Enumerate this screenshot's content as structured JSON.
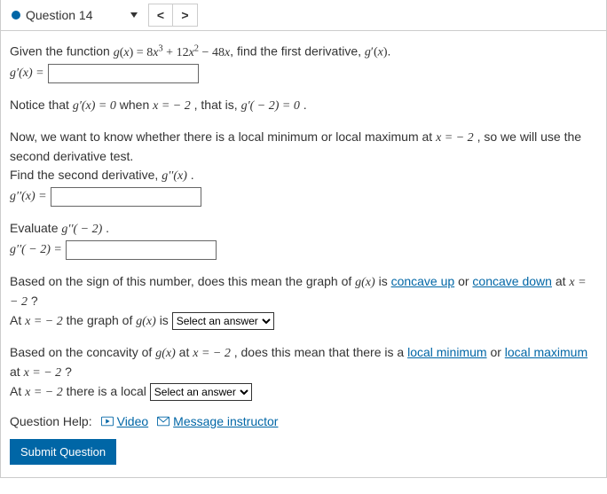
{
  "header": {
    "question_label": "Question 14",
    "prev_glyph": "<",
    "next_glyph": ">"
  },
  "p1": {
    "t1": "Given the function ",
    "fn": "g(x) = 8x³ + 12x² − 48x",
    "t2": ", find the first derivative, ",
    "d1": "g′(x)",
    "t3": "."
  },
  "row1": {
    "lhs": "g′(x) = "
  },
  "p2": {
    "t1": "Notice that ",
    "m1": "g′(x) = 0",
    "t2": " when ",
    "m2": "x = − 2",
    "t3": ", that is, ",
    "m3": "g′( − 2) = 0",
    "t4": "."
  },
  "p3": {
    "t1": "Now, we want to know whether there is a local minimum or local maximum at ",
    "m1": "x = − 2",
    "t2": ", so we will use the second derivative test.",
    "t3": "Find the second derivative, ",
    "m2": "g′′(x)",
    "t4": "."
  },
  "row2": {
    "lhs": "g′′(x) = "
  },
  "p4": {
    "t1": "Evaluate ",
    "m1": "g′′( − 2)",
    "t2": "."
  },
  "row3": {
    "lhs": "g′′( − 2) = "
  },
  "p5": {
    "t1": "Based on the sign of this number, does this mean the graph of ",
    "m1": "g(x)",
    "t2": " is ",
    "link1": "concave up",
    "t3": " or ",
    "link2": "concave down",
    "t4": " at ",
    "m2": "x = − 2",
    "t5": "?",
    "ans_pre1": "At ",
    "ans_m": "x = − 2",
    "ans_pre2": " the graph of ",
    "ans_m2": "g(x)",
    "ans_pre3": " is ",
    "select_placeholder": "Select an answer"
  },
  "p6": {
    "t1": "Based on the concavity of ",
    "m1": "g(x)",
    "t2": " at ",
    "m2": "x = − 2",
    "t3": ", does this mean that there is a ",
    "link1": "local minimum",
    "t4": " or ",
    "link2": "local maximum",
    "t5": " at ",
    "m3": "x = − 2",
    "t6": "?",
    "ans_pre1": "At ",
    "ans_m": "x = − 2",
    "ans_pre2": " there is a local ",
    "select_placeholder": "Select an answer"
  },
  "help": {
    "label": "Question Help:",
    "video": "Video",
    "msg": "Message instructor"
  },
  "submit": {
    "label": "Submit Question"
  }
}
